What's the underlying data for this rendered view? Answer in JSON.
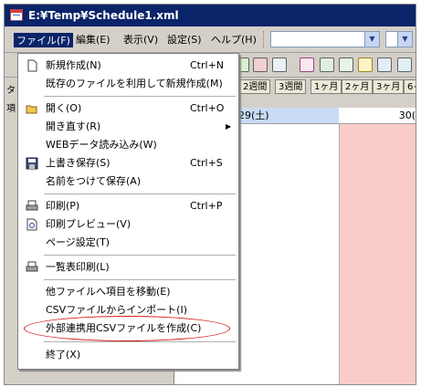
{
  "window": {
    "title": "E:¥Temp¥Schedule1.xml"
  },
  "menubar": {
    "file": "ファイル(F)",
    "edit": "編集(E)",
    "view": "表示(V)",
    "settings": "設定(S)",
    "help": "ヘルプ(H)"
  },
  "tabs": [
    "2週間",
    "3週間",
    "1ヶ月",
    "2ヶ月",
    "3ヶ月",
    "6ヶ"
  ],
  "left_pane": {
    "char1": "タ",
    "char2": "項"
  },
  "calendar": {
    "day1": "29(土)",
    "day2": "30("
  },
  "file_menu": {
    "new": {
      "label": "新規作成(N)",
      "shortcut": "Ctrl+N"
    },
    "new_from_existing": {
      "label": "既存のファイルを利用して新規作成(M)"
    },
    "open": {
      "label": "開く(O)",
      "shortcut": "Ctrl+O"
    },
    "reopen": {
      "label": "開き直す(R)"
    },
    "web_import": {
      "label": "WEBデータ読み込み(W)"
    },
    "save": {
      "label": "上書き保存(S)",
      "shortcut": "Ctrl+S"
    },
    "save_as": {
      "label": "名前をつけて保存(A)"
    },
    "print": {
      "label": "印刷(P)",
      "shortcut": "Ctrl+P"
    },
    "print_preview": {
      "label": "印刷プレビュー(V)"
    },
    "page_setup": {
      "label": "ページ設定(T)"
    },
    "list_print": {
      "label": "一覧表印刷(L)"
    },
    "move_items": {
      "label": "他ファイルへ項目を移動(E)"
    },
    "csv_import": {
      "label": "CSVファイルからインポート(I)"
    },
    "csv_export": {
      "label": "外部連携用CSVファイルを作成(C)"
    },
    "exit": {
      "label": "終了(X)"
    }
  },
  "colors": {
    "titlebar": "#0a246a",
    "highlight_ellipse": "#d41a1a",
    "weekend": "#f9ccc8",
    "selected_day": "#c8dcf4"
  }
}
